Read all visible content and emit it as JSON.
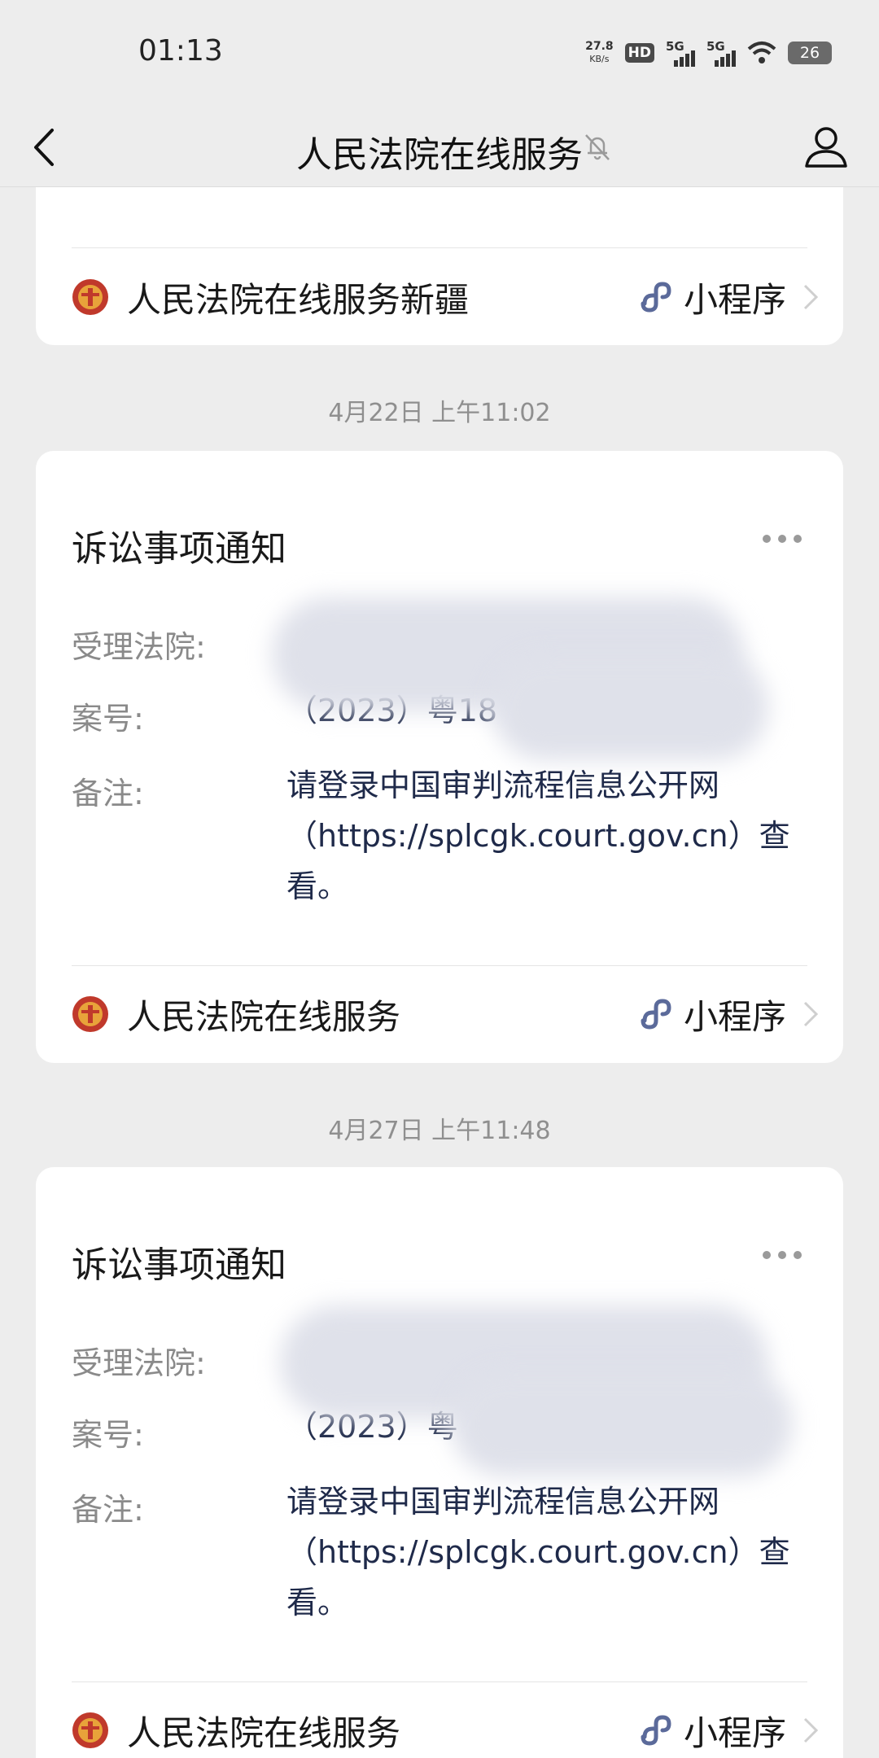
{
  "status_bar": {
    "time": "01:13",
    "net_speed_value": "27.8",
    "net_speed_unit": "KB/s",
    "hd_badge": "HD",
    "sim1_label": "5G",
    "sim2_label": "5G",
    "battery": "26"
  },
  "nav": {
    "title": "人民法院在线服务"
  },
  "cards": [
    {
      "footer_name": "人民法院在线服务新疆",
      "mini_label": "小程序"
    },
    {
      "timestamp": "4月22日 上午11:02",
      "title": "诉讼事项通知",
      "court_label": "受理法院:",
      "case_label": "案号:",
      "case_value": "（2023）粤18",
      "note_label": "备注:",
      "note_value": "请登录中国审判流程信息公开网（https://splcgk.court.gov.cn）查看。",
      "footer_name": "人民法院在线服务",
      "mini_label": "小程序"
    },
    {
      "timestamp": "4月27日 上午11:48",
      "title": "诉讼事项通知",
      "court_label": "受理法院:",
      "case_label": "案号:",
      "case_value": "（2023）粤",
      "note_label": "备注:",
      "note_value": "请登录中国审判流程信息公开网（https://splcgk.court.gov.cn）查看。",
      "footer_name": "人民法院在线服务",
      "mini_label": "小程序"
    }
  ],
  "colors": {
    "background": "#ededed",
    "card": "#ffffff",
    "value_text": "#1f2a4a",
    "label_text": "#8a8a8a",
    "mini_link_icon": "#5b6a9a",
    "court_logo": "#c0392b"
  }
}
